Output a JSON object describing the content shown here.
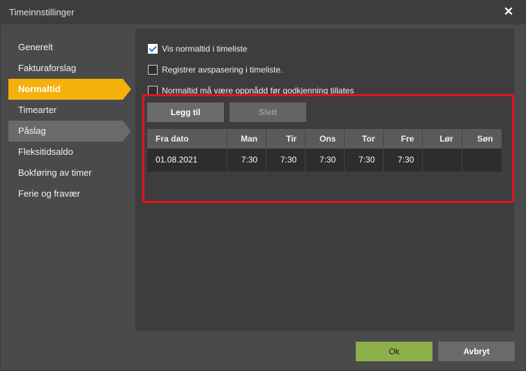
{
  "window": {
    "title": "Timeinnstillinger",
    "close_glyph": "✕"
  },
  "sidebar": {
    "items": [
      {
        "label": "Generelt",
        "state": "normal"
      },
      {
        "label": "Fakturaforslag",
        "state": "normal"
      },
      {
        "label": "Normaltid",
        "state": "active"
      },
      {
        "label": "Timearter",
        "state": "normal"
      },
      {
        "label": "Påslag",
        "state": "hover"
      },
      {
        "label": "Fleksitidsaldo",
        "state": "normal"
      },
      {
        "label": "Bokføring av timer",
        "state": "normal"
      },
      {
        "label": "Ferie og fravær",
        "state": "normal"
      }
    ]
  },
  "settings": {
    "checkboxes": [
      {
        "label": "Vis normaltid i timeliste",
        "checked": true
      },
      {
        "label": "Registrer avspasering i timeliste.",
        "checked": false
      },
      {
        "label": "Normaltid må være oppnådd før godkjenning tillates",
        "checked": false
      }
    ]
  },
  "toolbar": {
    "add_label": "Legg til",
    "delete_label": "Slett",
    "delete_disabled": true
  },
  "table": {
    "headers": [
      "Fra dato",
      "Man",
      "Tir",
      "Ons",
      "Tor",
      "Fre",
      "Lør",
      "Søn"
    ],
    "rows": [
      [
        "01.08.2021",
        "7:30",
        "7:30",
        "7:30",
        "7:30",
        "7:30",
        "",
        ""
      ]
    ]
  },
  "footer": {
    "ok_label": "Ok",
    "cancel_label": "Avbryt"
  },
  "colors": {
    "accent": "#f5b00a",
    "highlight_frame": "#e5121f",
    "ok_button": "#8db14a"
  },
  "icons": {
    "close": "close-icon",
    "checkbox_checked": "checkmark-icon"
  }
}
